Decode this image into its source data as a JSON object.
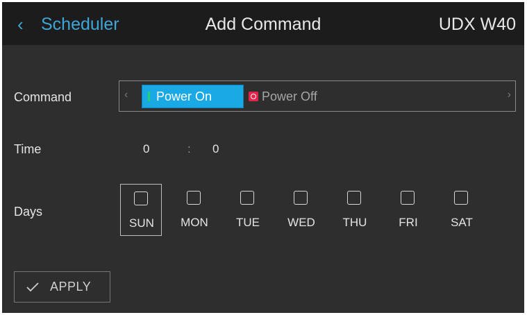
{
  "header": {
    "back_label": "Scheduler",
    "back_icon": "chevron-left-icon",
    "title": "Add Command",
    "device": "UDX W40"
  },
  "command": {
    "label": "Command",
    "options": [
      {
        "label": "Power On",
        "icon": "power-on-icon",
        "selected": true
      },
      {
        "label": "Power Off",
        "icon": "power-off-icon",
        "selected": false
      }
    ],
    "prev_icon": "chevron-left-icon",
    "next_icon": "chevron-right-icon"
  },
  "time": {
    "label": "Time",
    "hour": "0",
    "separator": ":",
    "minute": "0"
  },
  "days": {
    "label": "Days",
    "items": [
      {
        "label": "SUN",
        "checked": false,
        "focused": true
      },
      {
        "label": "MON",
        "checked": false
      },
      {
        "label": "TUE",
        "checked": false
      },
      {
        "label": "WED",
        "checked": false
      },
      {
        "label": "THU",
        "checked": false
      },
      {
        "label": "FRI",
        "checked": false
      },
      {
        "label": "SAT",
        "checked": false
      }
    ]
  },
  "apply": {
    "label": "APPLY",
    "icon": "checkmark-icon"
  },
  "colors": {
    "accent": "#3fa6d8",
    "selected_option": "#1aa9e4",
    "power_on": "#1fd46b",
    "power_off": "#e2244a",
    "background": "#2e2e2e",
    "header": "#1c1c1c"
  }
}
